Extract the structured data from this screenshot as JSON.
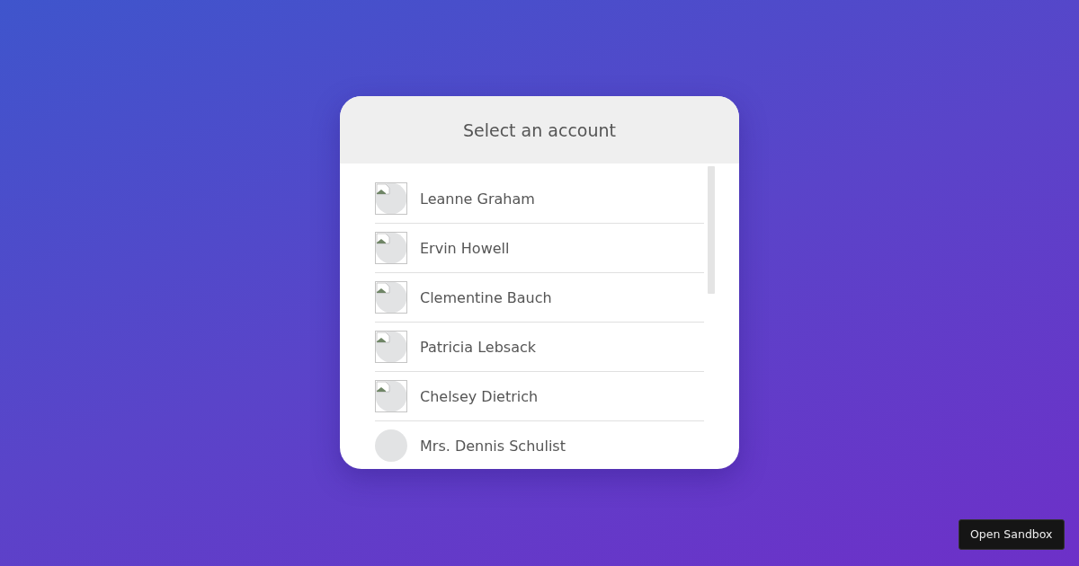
{
  "dialog": {
    "title": "Select an account"
  },
  "accounts": [
    {
      "name": "Leanne Graham",
      "kind": "broken"
    },
    {
      "name": "Ervin Howell",
      "kind": "broken"
    },
    {
      "name": "Clementine Bauch",
      "kind": "broken"
    },
    {
      "name": "Patricia Lebsack",
      "kind": "broken"
    },
    {
      "name": "Chelsey Dietrich",
      "kind": "broken"
    },
    {
      "name": "Mrs. Dennis Schulist",
      "kind": "placeholder"
    }
  ],
  "sandbox_button": {
    "label": "Open Sandbox"
  }
}
